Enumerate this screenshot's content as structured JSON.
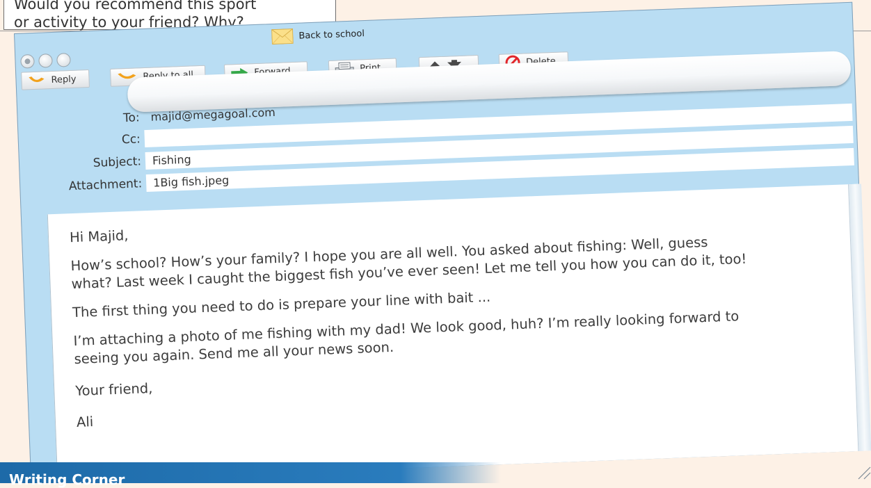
{
  "question": {
    "line1": "Would you recommend this sport",
    "line2": "or activity to your friend? Why?"
  },
  "window": {
    "title": "Back to school"
  },
  "toolbar": {
    "reply_label": "Reply",
    "reply_all_label": "Reply to all",
    "forward_label": "Forward",
    "print_label": "Print",
    "delete_label": "Delete"
  },
  "fields": {
    "to_label": "To:",
    "to_value": "majid@megagoal.com",
    "cc_label": "Cc:",
    "cc_value": "",
    "subject_label": "Subject:",
    "subject_value": "Fishing",
    "attachment_label": "Attachment:",
    "attachment_value": "1Big fish.jpeg"
  },
  "message": {
    "greeting": "Hi Majid,",
    "para1_line1": "How’s school? How’s your family? I hope you are all well. You asked about fishing: Well, guess",
    "para1_line2": "what? Last week I caught the biggest fish you’ve ever seen! Let me tell you how you can do it, too!",
    "para2": "The first thing you need to do is prepare your line with bait ...",
    "para3_line1": "I’m attaching a photo of me fishing with my dad! We look good, huh? I’m really looking forward to",
    "para3_line2": "seeing you again. Send me all your news soon.",
    "closing": "Your friend,",
    "signature": "Ali"
  },
  "footer": {
    "section_title": "Writing Corner"
  },
  "colors": {
    "window_blue": "#b9ddf3",
    "writing_corner_blue": "#1f6eab",
    "page_background": "#fdf1e6"
  },
  "icons": {
    "reply": "reply-arrow-icon",
    "reply_all": "reply-all-arrow-icon",
    "forward": "forward-arrow-icon",
    "print": "printer-icon",
    "up": "arrow-up-icon",
    "down": "arrow-down-icon",
    "delete": "delete-icon",
    "mail": "envelope-icon"
  }
}
